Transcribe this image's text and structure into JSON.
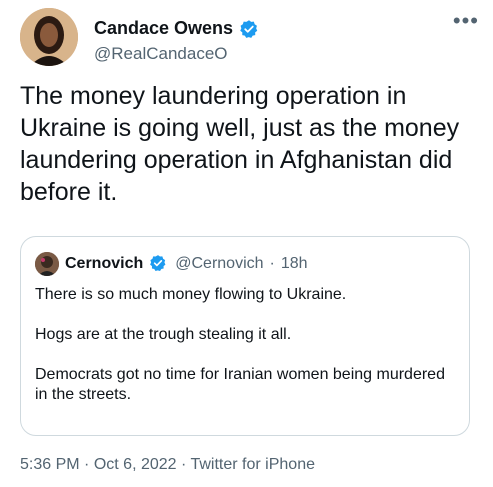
{
  "author": {
    "display_name": "Candace Owens",
    "handle": "@RealCandaceO"
  },
  "more_label": "•••",
  "tweet_text": "The money laundering operation in Ukraine is going well, just as the money laundering operation in Afghanistan did before it.",
  "quote": {
    "display_name": "Cernovich",
    "handle": "@Cernovich",
    "separator": "·",
    "time": "18h",
    "paragraphs": [
      "There is so much money flowing to Ukraine.",
      "Hogs are at the trough stealing it all.",
      "Democrats got no time for Iranian women being murdered in the streets."
    ]
  },
  "footer": {
    "time": "5:36 PM",
    "sep1": "·",
    "date": "Oct 6, 2022",
    "sep2": "·",
    "source": "Twitter for iPhone"
  },
  "colors": {
    "verified": "#1d9bf0",
    "muted": "#536471",
    "border": "#cfd9de"
  }
}
